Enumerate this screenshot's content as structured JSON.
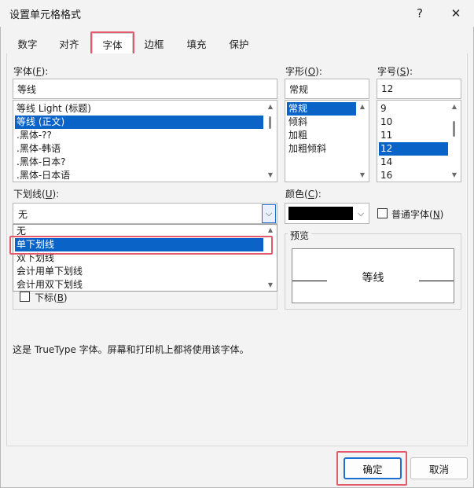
{
  "window": {
    "title": "设置单元格格式",
    "help": "?",
    "close": "✕"
  },
  "tabs": [
    "数字",
    "对齐",
    "字体",
    "边框",
    "填充",
    "保护"
  ],
  "font": {
    "label": "字体(F):",
    "label_pre": "字体(",
    "label_key": "F",
    "label_post": "):",
    "value": "等线",
    "items": [
      "等线 Light (标题)",
      "等线 (正文)",
      ".黑体-??",
      ".黑体-韩语",
      ".黑体-日本?",
      ".黑体-日本语"
    ],
    "selected": "等线 (正文)"
  },
  "style": {
    "label": "字形(O):",
    "label_pre": "字形(",
    "label_key": "O",
    "label_post": "):",
    "value": "常规",
    "items": [
      "常规",
      "倾斜",
      "加粗",
      "加粗倾斜"
    ],
    "selected": "常规"
  },
  "size": {
    "label": "字号(S):",
    "label_pre": "字号(",
    "label_key": "S",
    "label_post": "):",
    "value": "12",
    "items": [
      "9",
      "10",
      "11",
      "12",
      "14",
      "16"
    ],
    "selected": "12"
  },
  "underline": {
    "label": "下划线(U):",
    "label_pre": "下划线(",
    "label_key": "U",
    "label_post": "):",
    "value": "无",
    "options": [
      "无",
      "单下划线",
      "双下划线",
      "会计用单下划线",
      "会计用双下划线"
    ],
    "highlighted": "单下划线"
  },
  "color": {
    "label": "颜色(C):",
    "label_pre": "颜色(",
    "label_key": "C",
    "label_post": "):",
    "swatch": "#000000"
  },
  "normal_font": {
    "label": "普通字体(N)",
    "label_pre": "普通字体(",
    "label_key": "N",
    "label_post": ")",
    "checked": false
  },
  "effects": {
    "subscript": {
      "label": "下标(B)",
      "label_pre": "下标(",
      "label_key": "B",
      "label_post": ")",
      "checked": false
    }
  },
  "preview": {
    "label": "预览",
    "sample": "等线"
  },
  "info": "这是 TrueType 字体。屏幕和打印机上都将使用该字体。",
  "buttons": {
    "ok": "确定",
    "cancel": "取消"
  },
  "colors": {
    "selection": "#0a64c8",
    "highlight_box": "#e35a6c",
    "accent": "#1a6fd0"
  }
}
